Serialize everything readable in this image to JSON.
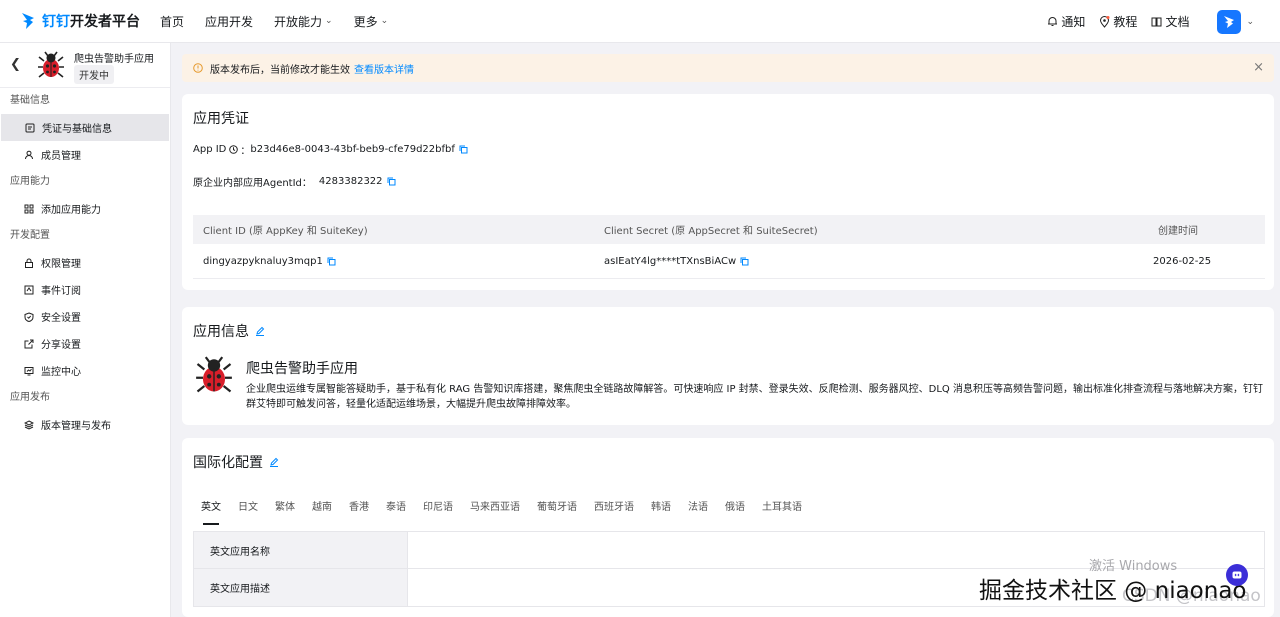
{
  "topnav": {
    "brand": "钉钉",
    "platform": "开发者平台",
    "items": [
      {
        "label": "首页"
      },
      {
        "label": "应用开发"
      },
      {
        "label": "开放能力",
        "dropdown": true
      },
      {
        "label": "更多",
        "dropdown": true
      }
    ],
    "right": {
      "notify": "通知",
      "tutorial": "教程",
      "docs": "文档"
    },
    "colors": {
      "brand": "#0089ff",
      "avatar": "#1677ff"
    }
  },
  "sidebar": {
    "app_name": "爬虫告警助手应用",
    "status": "开发中",
    "groups": [
      {
        "title": "基础信息",
        "items": [
          {
            "label": "凭证与基础信息",
            "icon": "credential-icon",
            "active": true
          },
          {
            "label": "成员管理",
            "icon": "user-icon"
          }
        ]
      },
      {
        "title": "应用能力",
        "items": [
          {
            "label": "添加应用能力",
            "icon": "grid-icon"
          }
        ]
      },
      {
        "title": "开发配置",
        "items": [
          {
            "label": "权限管理",
            "icon": "lock-icon"
          },
          {
            "label": "事件订阅",
            "icon": "event-icon"
          },
          {
            "label": "安全设置",
            "icon": "shield-icon"
          },
          {
            "label": "分享设置",
            "icon": "share-icon"
          },
          {
            "label": "监控中心",
            "icon": "monitor-icon"
          }
        ]
      },
      {
        "title": "应用发布",
        "items": [
          {
            "label": "版本管理与发布",
            "icon": "layers-icon"
          }
        ]
      }
    ]
  },
  "alert": {
    "text": "版本发布后，当前修改才能生效",
    "link": "查看版本详情"
  },
  "credentials": {
    "title": "应用凭证",
    "app_id_label": "App ID",
    "app_id_value": "b23d46e8-0043-43bf-beb9-cfe79d22bfbf",
    "agent_label": "原企业内部应用AgentId：",
    "agent_value": "4283382322",
    "table": {
      "headers": [
        "Client ID (原 AppKey 和 SuiteKey)",
        "Client Secret (原 AppSecret 和 SuiteSecret)",
        "创建时间"
      ],
      "row": [
        "dingyazpyknaluy3mqp1",
        "asIEatY4lg****tTXnsBiACw",
        "2026-02-25"
      ]
    }
  },
  "app_info": {
    "title": "应用信息",
    "name": "爬虫告警助手应用",
    "description": "企业爬虫运维专属智能答疑助手，基于私有化 RAG 告警知识库搭建，聚焦爬虫全链路故障解答。可快速响应 IP 封禁、登录失效、反爬检测、服务器风控、DLQ 消息积压等高频告警问题，输出标准化排查流程与落地解决方案，钉钉群艾特即可触发问答，轻量化适配运维场景，大幅提升爬虫故障排障效率。"
  },
  "i18n": {
    "title": "国际化配置",
    "tabs": [
      "英文",
      "日文",
      "繁体",
      "越南",
      "香港",
      "泰语",
      "印尼语",
      "马来西亚语",
      "葡萄牙语",
      "西班牙语",
      "韩语",
      "法语",
      "俄语",
      "土耳其语"
    ],
    "active_tab": 0,
    "rows": [
      {
        "label": "英文应用名称",
        "value": ""
      },
      {
        "label": "英文应用描述",
        "value": ""
      }
    ]
  },
  "watermarks": {
    "windows": "激活 Windows",
    "juejin": "掘金技术社区 @ niaonao",
    "csdn": "CSDN @niaonao"
  }
}
